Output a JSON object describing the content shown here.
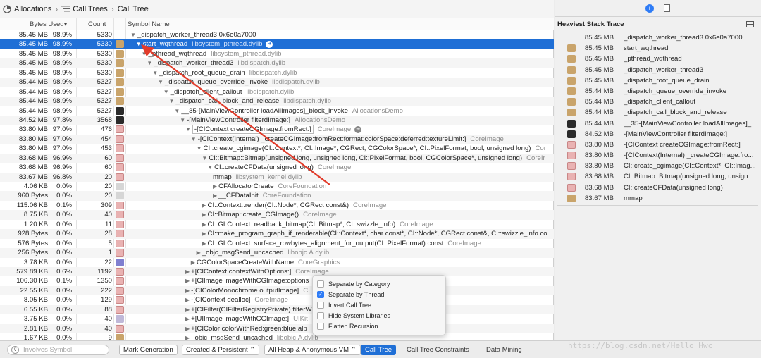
{
  "breadcrumbs": {
    "item1": "Allocations",
    "item2": "Call Trees",
    "item3": "Call Tree"
  },
  "columns": {
    "bytes_used": "Bytes Used▾",
    "count": "Count",
    "symbol": "Symbol Name"
  },
  "rows": [
    {
      "bytes": "85.45 MB",
      "pct": "98.9%",
      "count": "5330",
      "icon": "none",
      "indent": 0,
      "tri": "▼",
      "name": "_dispatch_worker_thread3  0x6e0a7000",
      "lib": "",
      "go": false
    },
    {
      "bytes": "85.45 MB",
      "pct": "98.9%",
      "count": "5330",
      "icon": "gear",
      "indent": 1,
      "tri": "▼",
      "name": "start_wqthread",
      "lib": "libsystem_pthread.dylib",
      "go": true,
      "selected": true
    },
    {
      "bytes": "85.45 MB",
      "pct": "98.9%",
      "count": "5330",
      "icon": "gear",
      "indent": 2,
      "tri": "▼",
      "name": "_pthread_wqthread",
      "lib": "libsystem_pthread.dylib",
      "go": false
    },
    {
      "bytes": "85.45 MB",
      "pct": "98.9%",
      "count": "5330",
      "icon": "gear",
      "indent": 3,
      "tri": "▼",
      "name": "_dispatch_worker_thread3",
      "lib": "libdispatch.dylib",
      "go": false
    },
    {
      "bytes": "85.45 MB",
      "pct": "98.9%",
      "count": "5330",
      "icon": "gear",
      "indent": 4,
      "tri": "▼",
      "name": "_dispatch_root_queue_drain",
      "lib": "libdispatch.dylib",
      "go": false
    },
    {
      "bytes": "85.44 MB",
      "pct": "98.9%",
      "count": "5327",
      "icon": "gear",
      "indent": 5,
      "tri": "▼",
      "name": "_dispatch_queue_override_invoke",
      "lib": "libdispatch.dylib",
      "go": false
    },
    {
      "bytes": "85.44 MB",
      "pct": "98.9%",
      "count": "5327",
      "icon": "gear",
      "indent": 6,
      "tri": "▼",
      "name": "_dispatch_client_callout",
      "lib": "libdispatch.dylib",
      "go": false
    },
    {
      "bytes": "85.44 MB",
      "pct": "98.9%",
      "count": "5327",
      "icon": "gear",
      "indent": 7,
      "tri": "▼",
      "name": "_dispatch_call_block_and_release",
      "lib": "libdispatch.dylib",
      "go": false
    },
    {
      "bytes": "85.44 MB",
      "pct": "98.9%",
      "count": "5327",
      "icon": "user",
      "indent": 8,
      "tri": "▼",
      "name": "__35-[MainViewController loadAllImages]_block_invoke",
      "lib": "AllocationsDemo",
      "go": false
    },
    {
      "bytes": "84.52 MB",
      "pct": "97.8%",
      "count": "3568",
      "icon": "user",
      "indent": 9,
      "tri": "▼",
      "name": "-[MainViewController filterdImage:]",
      "lib": "AllocationsDemo",
      "go": false
    },
    {
      "bytes": "83.80 MB",
      "pct": "97.0%",
      "count": "476",
      "icon": "box",
      "indent": 10,
      "tri": "▼",
      "name": "-[CIContext createCGImage:fromRect:]",
      "lib": "CoreImage",
      "go": true,
      "boxed": true
    },
    {
      "bytes": "83.80 MB",
      "pct": "97.0%",
      "count": "454",
      "icon": "box",
      "indent": 11,
      "tri": "▼",
      "name": "-[CIContext(Internal) _createCGImage:fromRect:format:colorSpace:deferred:textureLimit:]",
      "lib": "CoreImage",
      "go": false
    },
    {
      "bytes": "83.80 MB",
      "pct": "97.0%",
      "count": "453",
      "icon": "box",
      "indent": 12,
      "tri": "▼",
      "name": "CI::create_cgimage(CI::Context*, CI::Image*, CGRect, CGColorSpace*, CI::PixelFormat, bool, unsigned long)",
      "lib": "Cor",
      "go": false
    },
    {
      "bytes": "83.68 MB",
      "pct": "96.9%",
      "count": "60",
      "icon": "box",
      "indent": 13,
      "tri": "▼",
      "name": "CI::Bitmap::Bitmap(unsigned long, unsigned long, CI::PixelFormat, bool, CGColorSpace*, unsigned long)",
      "lib": "CoreIr",
      "go": false
    },
    {
      "bytes": "83.68 MB",
      "pct": "96.9%",
      "count": "60",
      "icon": "box",
      "indent": 14,
      "tri": "▼",
      "name": "CI::createCFData(unsigned long)",
      "lib": "CoreImage",
      "go": false
    },
    {
      "bytes": "83.67 MB",
      "pct": "96.8%",
      "count": "20",
      "icon": "box",
      "indent": 15,
      "tri": "",
      "name": "mmap",
      "lib": "libsystem_kernel.dylib",
      "go": false
    },
    {
      "bytes": "4.06 KB",
      "pct": "0.0%",
      "count": "20",
      "icon": "doc",
      "indent": 15,
      "tri": "▶",
      "name": "CFAllocatorCreate",
      "lib": "CoreFoundation",
      "go": false
    },
    {
      "bytes": "960 Bytes",
      "pct": "0.0%",
      "count": "20",
      "icon": "doc",
      "indent": 15,
      "tri": "▶",
      "name": "__CFDataInit",
      "lib": "CoreFoundation",
      "go": false
    },
    {
      "bytes": "115.06 KB",
      "pct": "0.1%",
      "count": "309",
      "icon": "box",
      "indent": 13,
      "tri": "▶",
      "name": "CI::Context::render(CI::Node*, CGRect const&)",
      "lib": "CoreImage",
      "go": false
    },
    {
      "bytes": "8.75 KB",
      "pct": "0.0%",
      "count": "40",
      "icon": "box",
      "indent": 13,
      "tri": "▶",
      "name": "CI::Bitmap::create_CGImage()",
      "lib": "CoreImage",
      "go": false
    },
    {
      "bytes": "1.20 KB",
      "pct": "0.0%",
      "count": "11",
      "icon": "box",
      "indent": 13,
      "tri": "▶",
      "name": "CI::GLContext::readback_bitmap(CI::Bitmap*, CI::swizzle_info)",
      "lib": "CoreImage",
      "go": false
    },
    {
      "bytes": "928 Bytes",
      "pct": "0.0%",
      "count": "28",
      "icon": "box",
      "indent": 13,
      "tri": "▶",
      "name": "CI::make_program_graph_if_renderable(CI::Context*, char const*, CI::Node*, CGRect const&, CI::swizzle_info co",
      "lib": "",
      "go": false
    },
    {
      "bytes": "576 Bytes",
      "pct": "0.0%",
      "count": "5",
      "icon": "box",
      "indent": 13,
      "tri": "▶",
      "name": "CI::GLContext::surface_rowbytes_alignment_for_output(CI::PixelFormat) const",
      "lib": "CoreImage",
      "go": false
    },
    {
      "bytes": "256 Bytes",
      "pct": "0.0%",
      "count": "1",
      "icon": "box",
      "indent": 12,
      "tri": "▶",
      "name": "_objc_msgSend_uncached",
      "lib": "libobjc.A.dylib",
      "go": false
    },
    {
      "bytes": "3.78 KB",
      "pct": "0.0%",
      "count": "22",
      "icon": "blue",
      "indent": 11,
      "tri": "▶",
      "name": "CGColorSpaceCreateWithName",
      "lib": "CoreGraphics",
      "go": false
    },
    {
      "bytes": "579.89 KB",
      "pct": "0.6%",
      "count": "1192",
      "icon": "box",
      "indent": 10,
      "tri": "▶",
      "name": "+[CIContext contextWithOptions:]",
      "lib": "CoreImage",
      "go": false
    },
    {
      "bytes": "106.30 KB",
      "pct": "0.1%",
      "count": "1350",
      "icon": "box",
      "indent": 10,
      "tri": "▶",
      "name": "+[CIImage imageWithCGImage:options",
      "lib": "",
      "go": false
    },
    {
      "bytes": "22.55 KB",
      "pct": "0.0%",
      "count": "222",
      "icon": "box",
      "indent": 10,
      "tri": "▶",
      "name": "-[CIColorMonochrome outputImage]",
      "lib": "C",
      "go": false
    },
    {
      "bytes": "8.05 KB",
      "pct": "0.0%",
      "count": "129",
      "icon": "box",
      "indent": 10,
      "tri": "▶",
      "name": "-[CIContext dealloc]",
      "lib": "CoreImage",
      "go": false
    },
    {
      "bytes": "6.55 KB",
      "pct": "0.0%",
      "count": "88",
      "icon": "box",
      "indent": 10,
      "tri": "▶",
      "name": "+[CIFilter(CIFilterRegistryPrivate) filterW",
      "lib": "",
      "go": false
    },
    {
      "bytes": "3.75 KB",
      "pct": "0.0%",
      "count": "40",
      "icon": "pk",
      "indent": 10,
      "tri": "▶",
      "name": "+[UIImage imageWithCGImage:]",
      "lib": "UIKit",
      "go": false
    },
    {
      "bytes": "2.81 KB",
      "pct": "0.0%",
      "count": "40",
      "icon": "box",
      "indent": 10,
      "tri": "▶",
      "name": "+[CIColor colorWithRed:green:blue:alp",
      "lib": "",
      "go": false
    },
    {
      "bytes": "1.67 KB",
      "pct": "0.0%",
      "count": "9",
      "icon": "gear",
      "indent": 10,
      "tri": "▶",
      "name": "_objc_msgSend_uncached",
      "lib": "libobjc.A.dylib",
      "go": false
    }
  ],
  "popover": {
    "options": [
      {
        "label": "Separate by Category",
        "checked": false
      },
      {
        "label": "Separate by Thread",
        "checked": true
      },
      {
        "label": "Invert Call Tree",
        "checked": false
      },
      {
        "label": "Hide System Libraries",
        "checked": false
      },
      {
        "label": "Flatten Recursion",
        "checked": false
      }
    ]
  },
  "bottombar": {
    "filter_placeholder": "Involves Symbol",
    "mark_generation": "Mark Generation",
    "lifespan": "Created & Persistent",
    "heap": "All Heap & Anonymous VM",
    "tabs": [
      "Call Tree",
      "Call Tree Constraints",
      "Data Mining"
    ],
    "active_tab": "Call Tree"
  },
  "inspector": {
    "title": "Heaviest Stack Trace",
    "header_bytes": "85.45 MB",
    "header_symbol": "_dispatch_worker_thread3  0x6e0a7000",
    "frames": [
      {
        "icon": "gear",
        "bytes": "85.45 MB",
        "symbol": "start_wqthread"
      },
      {
        "icon": "gear",
        "bytes": "85.45 MB",
        "symbol": "_pthread_wqthread"
      },
      {
        "icon": "gear",
        "bytes": "85.45 MB",
        "symbol": "_dispatch_worker_thread3"
      },
      {
        "icon": "gear",
        "bytes": "85.45 MB",
        "symbol": "_dispatch_root_queue_drain"
      },
      {
        "icon": "gear",
        "bytes": "85.44 MB",
        "symbol": "_dispatch_queue_override_invoke"
      },
      {
        "icon": "gear",
        "bytes": "85.44 MB",
        "symbol": "_dispatch_client_callout"
      },
      {
        "icon": "gear",
        "bytes": "85.44 MB",
        "symbol": "_dispatch_call_block_and_release"
      },
      {
        "icon": "user",
        "bytes": "85.44 MB",
        "symbol": "__35-[MainViewController loadAllImages]_..."
      },
      {
        "icon": "user",
        "bytes": "84.52 MB",
        "symbol": "-[MainViewController filterdImage:]"
      },
      {
        "icon": "box",
        "bytes": "83.80 MB",
        "symbol": "-[CIContext createCGImage:fromRect:]"
      },
      {
        "icon": "box",
        "bytes": "83.80 MB",
        "symbol": "-[CIContext(Internal) _createCGImage:fro..."
      },
      {
        "icon": "box",
        "bytes": "83.80 MB",
        "symbol": "CI::create_cgimage(CI::Context*, CI::Imag..."
      },
      {
        "icon": "box",
        "bytes": "83.68 MB",
        "symbol": "CI::Bitmap::Bitmap(unsigned long, unsign..."
      },
      {
        "icon": "box",
        "bytes": "83.68 MB",
        "symbol": "CI::createCFData(unsigned long)"
      },
      {
        "icon": "gear",
        "bytes": "83.67 MB",
        "symbol": "mmap"
      }
    ]
  },
  "watermark": "https://blog.csdn.net/Hello_Hwc",
  "colors": {
    "selection": "#1f6fd6",
    "annotation_arrow": "#e23b2a"
  }
}
